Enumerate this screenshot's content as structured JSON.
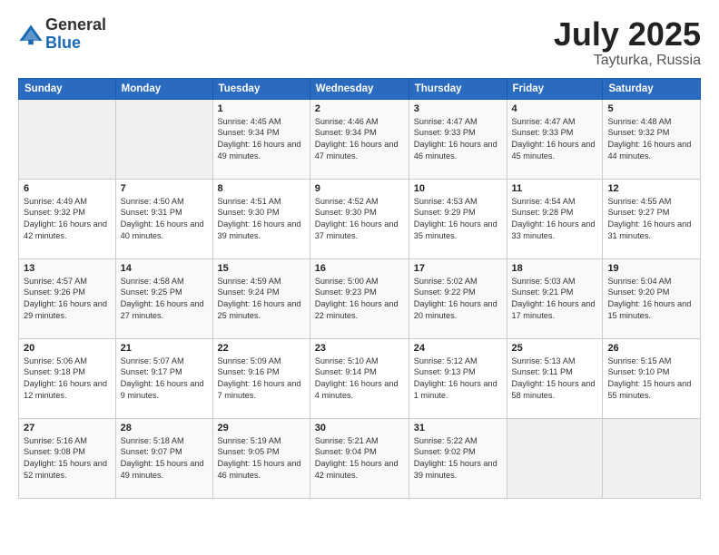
{
  "header": {
    "logo_general": "General",
    "logo_blue": "Blue",
    "title": "July 2025",
    "location": "Tayturka, Russia"
  },
  "days_of_week": [
    "Sunday",
    "Monday",
    "Tuesday",
    "Wednesday",
    "Thursday",
    "Friday",
    "Saturday"
  ],
  "weeks": [
    [
      {
        "day": "",
        "info": ""
      },
      {
        "day": "",
        "info": ""
      },
      {
        "day": "1",
        "info": "Sunrise: 4:45 AM\nSunset: 9:34 PM\nDaylight: 16 hours\nand 49 minutes."
      },
      {
        "day": "2",
        "info": "Sunrise: 4:46 AM\nSunset: 9:34 PM\nDaylight: 16 hours\nand 47 minutes."
      },
      {
        "day": "3",
        "info": "Sunrise: 4:47 AM\nSunset: 9:33 PM\nDaylight: 16 hours\nand 46 minutes."
      },
      {
        "day": "4",
        "info": "Sunrise: 4:47 AM\nSunset: 9:33 PM\nDaylight: 16 hours\nand 45 minutes."
      },
      {
        "day": "5",
        "info": "Sunrise: 4:48 AM\nSunset: 9:32 PM\nDaylight: 16 hours\nand 44 minutes."
      }
    ],
    [
      {
        "day": "6",
        "info": "Sunrise: 4:49 AM\nSunset: 9:32 PM\nDaylight: 16 hours\nand 42 minutes."
      },
      {
        "day": "7",
        "info": "Sunrise: 4:50 AM\nSunset: 9:31 PM\nDaylight: 16 hours\nand 40 minutes."
      },
      {
        "day": "8",
        "info": "Sunrise: 4:51 AM\nSunset: 9:30 PM\nDaylight: 16 hours\nand 39 minutes."
      },
      {
        "day": "9",
        "info": "Sunrise: 4:52 AM\nSunset: 9:30 PM\nDaylight: 16 hours\nand 37 minutes."
      },
      {
        "day": "10",
        "info": "Sunrise: 4:53 AM\nSunset: 9:29 PM\nDaylight: 16 hours\nand 35 minutes."
      },
      {
        "day": "11",
        "info": "Sunrise: 4:54 AM\nSunset: 9:28 PM\nDaylight: 16 hours\nand 33 minutes."
      },
      {
        "day": "12",
        "info": "Sunrise: 4:55 AM\nSunset: 9:27 PM\nDaylight: 16 hours\nand 31 minutes."
      }
    ],
    [
      {
        "day": "13",
        "info": "Sunrise: 4:57 AM\nSunset: 9:26 PM\nDaylight: 16 hours\nand 29 minutes."
      },
      {
        "day": "14",
        "info": "Sunrise: 4:58 AM\nSunset: 9:25 PM\nDaylight: 16 hours\nand 27 minutes."
      },
      {
        "day": "15",
        "info": "Sunrise: 4:59 AM\nSunset: 9:24 PM\nDaylight: 16 hours\nand 25 minutes."
      },
      {
        "day": "16",
        "info": "Sunrise: 5:00 AM\nSunset: 9:23 PM\nDaylight: 16 hours\nand 22 minutes."
      },
      {
        "day": "17",
        "info": "Sunrise: 5:02 AM\nSunset: 9:22 PM\nDaylight: 16 hours\nand 20 minutes."
      },
      {
        "day": "18",
        "info": "Sunrise: 5:03 AM\nSunset: 9:21 PM\nDaylight: 16 hours\nand 17 minutes."
      },
      {
        "day": "19",
        "info": "Sunrise: 5:04 AM\nSunset: 9:20 PM\nDaylight: 16 hours\nand 15 minutes."
      }
    ],
    [
      {
        "day": "20",
        "info": "Sunrise: 5:06 AM\nSunset: 9:18 PM\nDaylight: 16 hours\nand 12 minutes."
      },
      {
        "day": "21",
        "info": "Sunrise: 5:07 AM\nSunset: 9:17 PM\nDaylight: 16 hours\nand 9 minutes."
      },
      {
        "day": "22",
        "info": "Sunrise: 5:09 AM\nSunset: 9:16 PM\nDaylight: 16 hours\nand 7 minutes."
      },
      {
        "day": "23",
        "info": "Sunrise: 5:10 AM\nSunset: 9:14 PM\nDaylight: 16 hours\nand 4 minutes."
      },
      {
        "day": "24",
        "info": "Sunrise: 5:12 AM\nSunset: 9:13 PM\nDaylight: 16 hours\nand 1 minute."
      },
      {
        "day": "25",
        "info": "Sunrise: 5:13 AM\nSunset: 9:11 PM\nDaylight: 15 hours\nand 58 minutes."
      },
      {
        "day": "26",
        "info": "Sunrise: 5:15 AM\nSunset: 9:10 PM\nDaylight: 15 hours\nand 55 minutes."
      }
    ],
    [
      {
        "day": "27",
        "info": "Sunrise: 5:16 AM\nSunset: 9:08 PM\nDaylight: 15 hours\nand 52 minutes."
      },
      {
        "day": "28",
        "info": "Sunrise: 5:18 AM\nSunset: 9:07 PM\nDaylight: 15 hours\nand 49 minutes."
      },
      {
        "day": "29",
        "info": "Sunrise: 5:19 AM\nSunset: 9:05 PM\nDaylight: 15 hours\nand 46 minutes."
      },
      {
        "day": "30",
        "info": "Sunrise: 5:21 AM\nSunset: 9:04 PM\nDaylight: 15 hours\nand 42 minutes."
      },
      {
        "day": "31",
        "info": "Sunrise: 5:22 AM\nSunset: 9:02 PM\nDaylight: 15 hours\nand 39 minutes."
      },
      {
        "day": "",
        "info": ""
      },
      {
        "day": "",
        "info": ""
      }
    ]
  ]
}
